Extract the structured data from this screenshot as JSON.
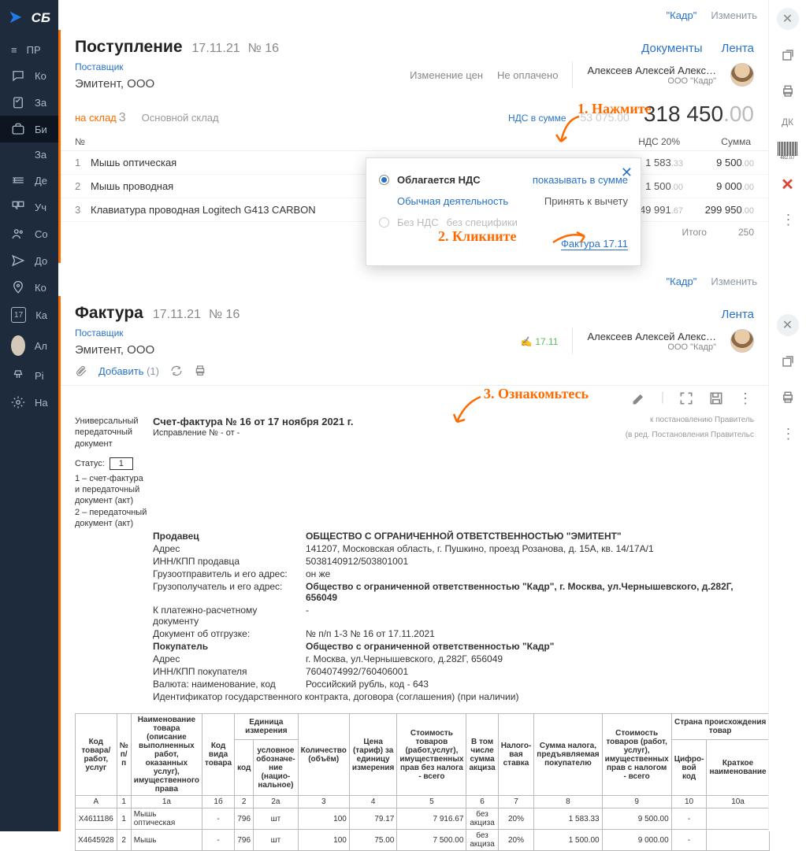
{
  "brand": "СБ",
  "nav": {
    "items": [
      "ПР",
      "Ко",
      "За",
      "Би",
      "За",
      "Де",
      "Уч",
      "Со",
      "До",
      "Ко",
      "Ка",
      "Ал",
      "Pi",
      "На"
    ],
    "cal": "17"
  },
  "topbar1": {
    "org": "\"Кадр\"",
    "change": "Изменить"
  },
  "topbar2": {
    "org": "\"Кадр\"",
    "change": "Изменить"
  },
  "receipt": {
    "title": "Поступление",
    "date": "17.11.21",
    "num": "№ 16",
    "docs": "Документы",
    "feed": "Лента",
    "priceChange": "Изменение цен",
    "unpaid": "Не оплачено",
    "owner": "Алексеев Алексей Алекс…",
    "ownerOrg": "ООО \"Кадр\"",
    "supplierLabel": "Поставщик",
    "supplier": "Эмитент, ООО",
    "whLabel": "на склад",
    "whCount": "3",
    "whName": "Основной склад",
    "vatLabel": "НДС в сумме",
    "sumOld": "53 075",
    "sumOldDec": ".00",
    "total": "318 450",
    "totalDec": ".00",
    "th": {
      "n": "№",
      "vat": "НДС 20%",
      "sum": "Сумма"
    },
    "rows": [
      {
        "n": "1",
        "name": "Мышь оптическая",
        "vat": "1 583",
        "vatDec": ".33",
        "sum": "9 500",
        "sumDec": ".00"
      },
      {
        "n": "2",
        "name": "Мышь проводная",
        "vat": "1 500",
        "vatDec": ".00",
        "sum": "9 000",
        "sumDec": ".00"
      },
      {
        "n": "3",
        "name": "Клавиатура проводная Logitech G413 CARBON",
        "vat": "49 991",
        "vatDec": ".67",
        "sum": "299 950",
        "sumDec": ".00"
      }
    ],
    "itogo": "Итого",
    "itogoVal": "250"
  },
  "popup": {
    "r1": "Облагается НДС",
    "r1b": "показывать в сумме",
    "r2": "Обычная деятельность",
    "r2b": "Принять к вычету",
    "r3": "Без НДС",
    "r3b": "без специфики",
    "link": "Фактура 17.11"
  },
  "ann": {
    "a1": "1. Нажмите",
    "a2": "2. Кликните",
    "a3": "3. Ознакомьтесь"
  },
  "invoice": {
    "title": "Фактура",
    "date": "17.11.21",
    "num": "№ 16",
    "feed": "Лента",
    "stamp": "17.11",
    "owner": "Алексеев Алексей Алекс…",
    "ownerOrg": "ООО \"Кадр\"",
    "supplierLabel": "Поставщик",
    "supplier": "Эмитент, ООО",
    "add": "Добавить",
    "addCount": "(1)"
  },
  "doc": {
    "sideTitle": "Универсальный передаточный документ",
    "statusLabel": "Статус:",
    "status": "1",
    "statusNote1": "1 – счет-фактура и передаточный документ (акт)",
    "statusNote2": "2 – передаточный документ (акт)",
    "h": "Счет-фактура № 16 от 17 ноября 2021 г.",
    "corr": "Исправление № - от -",
    "right1": "к постановлению Правитель",
    "right2": "(в ред. Постановления Правительс",
    "seller": "Продавец",
    "sellerVal": "ОБЩЕСТВО С ОГРАНИЧЕННОЙ ОТВЕТСТВЕННОСТЬЮ \"ЭМИТЕНТ\"",
    "addr": "Адрес",
    "addrVal": "141207, Московская область, г. Пушкино, проезд Розанова, д. 15А, кв. 14/17А/1",
    "inn": "ИНН/КПП продавца",
    "innVal": "5038140912/503801001",
    "sender": "Грузоотправитель и его адрес:",
    "senderVal": "он же",
    "recv": "Грузополучатель и его адрес:",
    "recvVal": "Общество с ограниченной ответственностью \"Кадр\", г. Москва, ул.Чернышевского, д.282Г, 656049",
    "pay": "К платежно-расчетному документу",
    "payVal": "-",
    "ship": "Документ об отгрузке:",
    "shipVal": "№ п/п 1-3 № 16 от 17.11.2021",
    "buyer": "Покупатель",
    "buyerVal": "Общество с ограниченной ответственностью \"Кадр\"",
    "baddr": "Адрес",
    "baddrVal": "г. Москва, ул.Чернышевского, д.282Г, 656049",
    "binn": "ИНН/КПП покупателя",
    "binnVal": "7604074992/760406001",
    "curr": "Валюта: наименование, код",
    "currVal": "Российский рубль, код - 643",
    "gov": "Идентификатор государственного контракта, договора (соглашения) (при наличии)",
    "th": {
      "code": "Код товара/ работ, услуг",
      "n": "№ п/п",
      "name": "Наименование товара (описание выполненных работ, оказанных услуг), имущественного права",
      "kind": "Код вида товара",
      "unit": "Единица измерения",
      "ucode": "код",
      "usym": "условное обозначе-ние (нацио-нальное)",
      "qty": "Количество (объём)",
      "price": "Цена (тариф) за единицу измерения",
      "cost": "Стоимость товаров (работ,услуг), имущественных прав без налога - всего",
      "excise": "В том числе сумма акциза",
      "rate": "Налого-вая ставка",
      "tax": "Сумма налога, предъявляемая покупателю",
      "total": "Стоимость товаров (работ, услуг), имущественных прав с налогом - всего",
      "country": "Страна происхождения товар",
      "ccode": "Цифро-вой код",
      "cname": "Краткое наименование"
    },
    "cn": [
      "А",
      "1",
      "1а",
      "1б",
      "2",
      "2а",
      "3",
      "4",
      "5",
      "6",
      "7",
      "8",
      "9",
      "10",
      "10а"
    ],
    "rows": [
      {
        "code": "X4611186",
        "n": "1",
        "name": "Мышь оптическая",
        "kind": "-",
        "ucode": "796",
        "usym": "шт",
        "qty": "100",
        "price": "79.17",
        "cost": "7 916.67",
        "excise": "без акциза",
        "rate": "20%",
        "tax": "1 583.33",
        "total": "9 500.00",
        "cc": "-"
      },
      {
        "code": "X4645928",
        "n": "2",
        "name": "Мышь",
        "kind": "-",
        "ucode": "796",
        "usym": "шт",
        "qty": "100",
        "price": "75.00",
        "cost": "7 500.00",
        "excise": "без акциза",
        "rate": "20%",
        "tax": "1 500.00",
        "total": "9 000.00",
        "cc": "-"
      }
    ]
  },
  "side": {
    "dk": "ДК"
  }
}
